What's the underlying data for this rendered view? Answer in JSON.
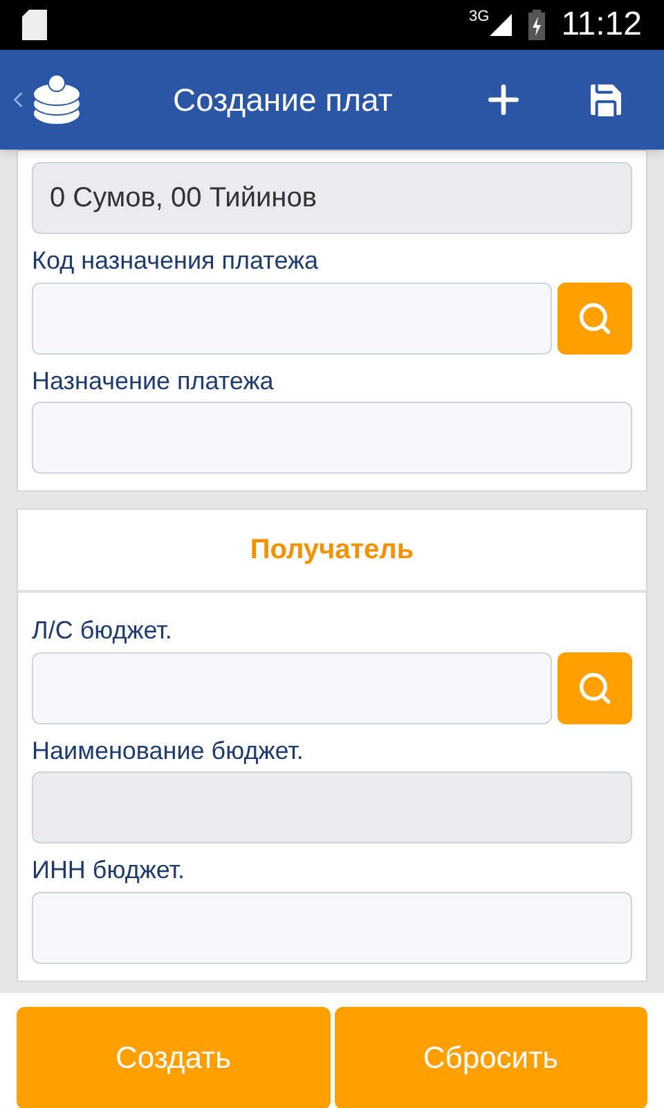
{
  "status_bar": {
    "network": "3G",
    "time": "11:12"
  },
  "app_bar": {
    "title": "Создание плат"
  },
  "sections": [
    {
      "fields": [
        {
          "value": "0 Сумов, 00 Тийинов",
          "disabled": true,
          "lookup": false
        },
        {
          "label": "Код назначения платежа",
          "disabled": false,
          "lookup": true
        },
        {
          "label": "Назначение платежа",
          "disabled": false,
          "lookup": false
        }
      ]
    },
    {
      "header": "Получатель",
      "fields": [
        {
          "label": "Л/С бюджет.",
          "disabled": false,
          "lookup": true
        },
        {
          "label": "Наименование бюджет.",
          "disabled": true,
          "lookup": false
        },
        {
          "label": "ИНН бюджет.",
          "disabled": false,
          "lookup": false
        }
      ]
    }
  ],
  "buttons": [
    "Создать",
    "Сбросить"
  ]
}
